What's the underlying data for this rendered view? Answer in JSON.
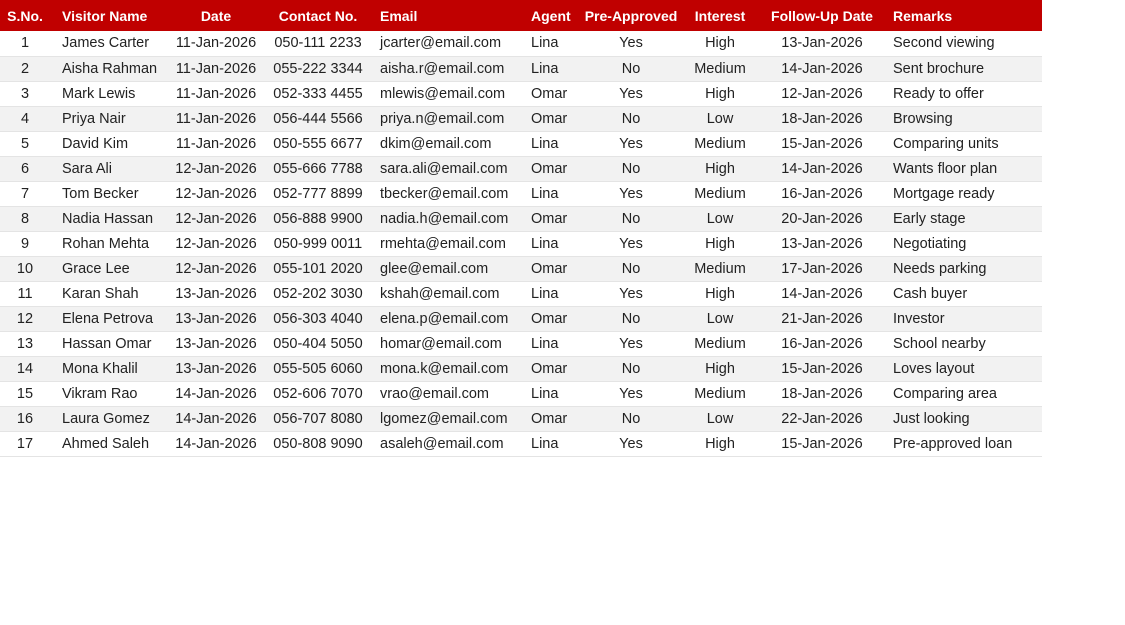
{
  "columns": [
    "S.No.",
    "Visitor Name",
    "Date",
    "Contact No.",
    "Email",
    "Agent",
    "Pre-Approved",
    "Interest",
    "Follow-Up Date",
    "Remarks"
  ],
  "rows": [
    [
      "1",
      "James Carter",
      "11-Jan-2026",
      "050-111 2233",
      "jcarter@email.com",
      "Lina",
      "Yes",
      "High",
      "13-Jan-2026",
      "Second viewing"
    ],
    [
      "2",
      "Aisha Rahman",
      "11-Jan-2026",
      "055-222 3344",
      "aisha.r@email.com",
      "Lina",
      "No",
      "Medium",
      "14-Jan-2026",
      "Sent brochure"
    ],
    [
      "3",
      "Mark Lewis",
      "11-Jan-2026",
      "052-333 4455",
      "mlewis@email.com",
      "Omar",
      "Yes",
      "High",
      "12-Jan-2026",
      "Ready to offer"
    ],
    [
      "4",
      "Priya Nair",
      "11-Jan-2026",
      "056-444 5566",
      "priya.n@email.com",
      "Omar",
      "No",
      "Low",
      "18-Jan-2026",
      "Browsing"
    ],
    [
      "5",
      "David Kim",
      "11-Jan-2026",
      "050-555 6677",
      "dkim@email.com",
      "Lina",
      "Yes",
      "Medium",
      "15-Jan-2026",
      "Comparing units"
    ],
    [
      "6",
      "Sara Ali",
      "12-Jan-2026",
      "055-666 7788",
      "sara.ali@email.com",
      "Omar",
      "No",
      "High",
      "14-Jan-2026",
      "Wants floor plan"
    ],
    [
      "7",
      "Tom Becker",
      "12-Jan-2026",
      "052-777 8899",
      "tbecker@email.com",
      "Lina",
      "Yes",
      "Medium",
      "16-Jan-2026",
      "Mortgage ready"
    ],
    [
      "8",
      "Nadia Hassan",
      "12-Jan-2026",
      "056-888 9900",
      "nadia.h@email.com",
      "Omar",
      "No",
      "Low",
      "20-Jan-2026",
      "Early stage"
    ],
    [
      "9",
      "Rohan Mehta",
      "12-Jan-2026",
      "050-999 0011",
      "rmehta@email.com",
      "Lina",
      "Yes",
      "High",
      "13-Jan-2026",
      "Negotiating"
    ],
    [
      "10",
      "Grace Lee",
      "12-Jan-2026",
      "055-101 2020",
      "glee@email.com",
      "Omar",
      "No",
      "Medium",
      "17-Jan-2026",
      "Needs parking"
    ],
    [
      "11",
      "Karan Shah",
      "13-Jan-2026",
      "052-202 3030",
      "kshah@email.com",
      "Lina",
      "Yes",
      "High",
      "14-Jan-2026",
      "Cash buyer"
    ],
    [
      "12",
      "Elena Petrova",
      "13-Jan-2026",
      "056-303 4040",
      "elena.p@email.com",
      "Omar",
      "No",
      "Low",
      "21-Jan-2026",
      "Investor"
    ],
    [
      "13",
      "Hassan Omar",
      "13-Jan-2026",
      "050-404 5050",
      "homar@email.com",
      "Lina",
      "Yes",
      "Medium",
      "16-Jan-2026",
      "School nearby"
    ],
    [
      "14",
      "Mona Khalil",
      "13-Jan-2026",
      "055-505 6060",
      "mona.k@email.com",
      "Omar",
      "No",
      "High",
      "15-Jan-2026",
      "Loves layout"
    ],
    [
      "15",
      "Vikram Rao",
      "14-Jan-2026",
      "052-606 7070",
      "vrao@email.com",
      "Lina",
      "Yes",
      "Medium",
      "18-Jan-2026",
      "Comparing area"
    ],
    [
      "16",
      "Laura Gomez",
      "14-Jan-2026",
      "056-707 8080",
      "lgomez@email.com",
      "Omar",
      "No",
      "Low",
      "22-Jan-2026",
      "Just looking"
    ],
    [
      "17",
      "Ahmed Saleh",
      "14-Jan-2026",
      "050-808 9090",
      "asaleh@email.com",
      "Lina",
      "Yes",
      "High",
      "15-Jan-2026",
      "Pre-approved loan"
    ]
  ],
  "colors": {
    "header_bg": "#c00000",
    "header_text": "#ffffff",
    "zebra_bg": "#f2f2f2"
  }
}
